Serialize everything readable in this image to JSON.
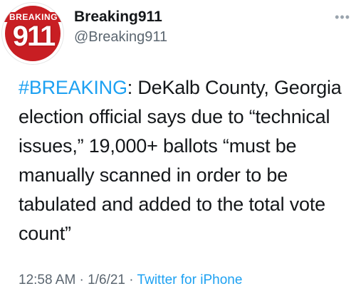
{
  "user": {
    "avatar_top": "BREAKING",
    "avatar_num": "911",
    "name": "Breaking911",
    "handle": "@Breaking911"
  },
  "more_icon": "more-horizontal-icon",
  "tweet": {
    "hashtag": "#BREAKING",
    "text": ": DeKalb County, Georgia election official says due to “technical issues,” 19,000+ ballots “must be manually scanned in order to be tabulated and added to the total vote count”"
  },
  "meta": {
    "time": "12:58 AM",
    "sep1": " · ",
    "date": "1/6/21",
    "sep2": " · ",
    "source": "Twitter for iPhone"
  }
}
